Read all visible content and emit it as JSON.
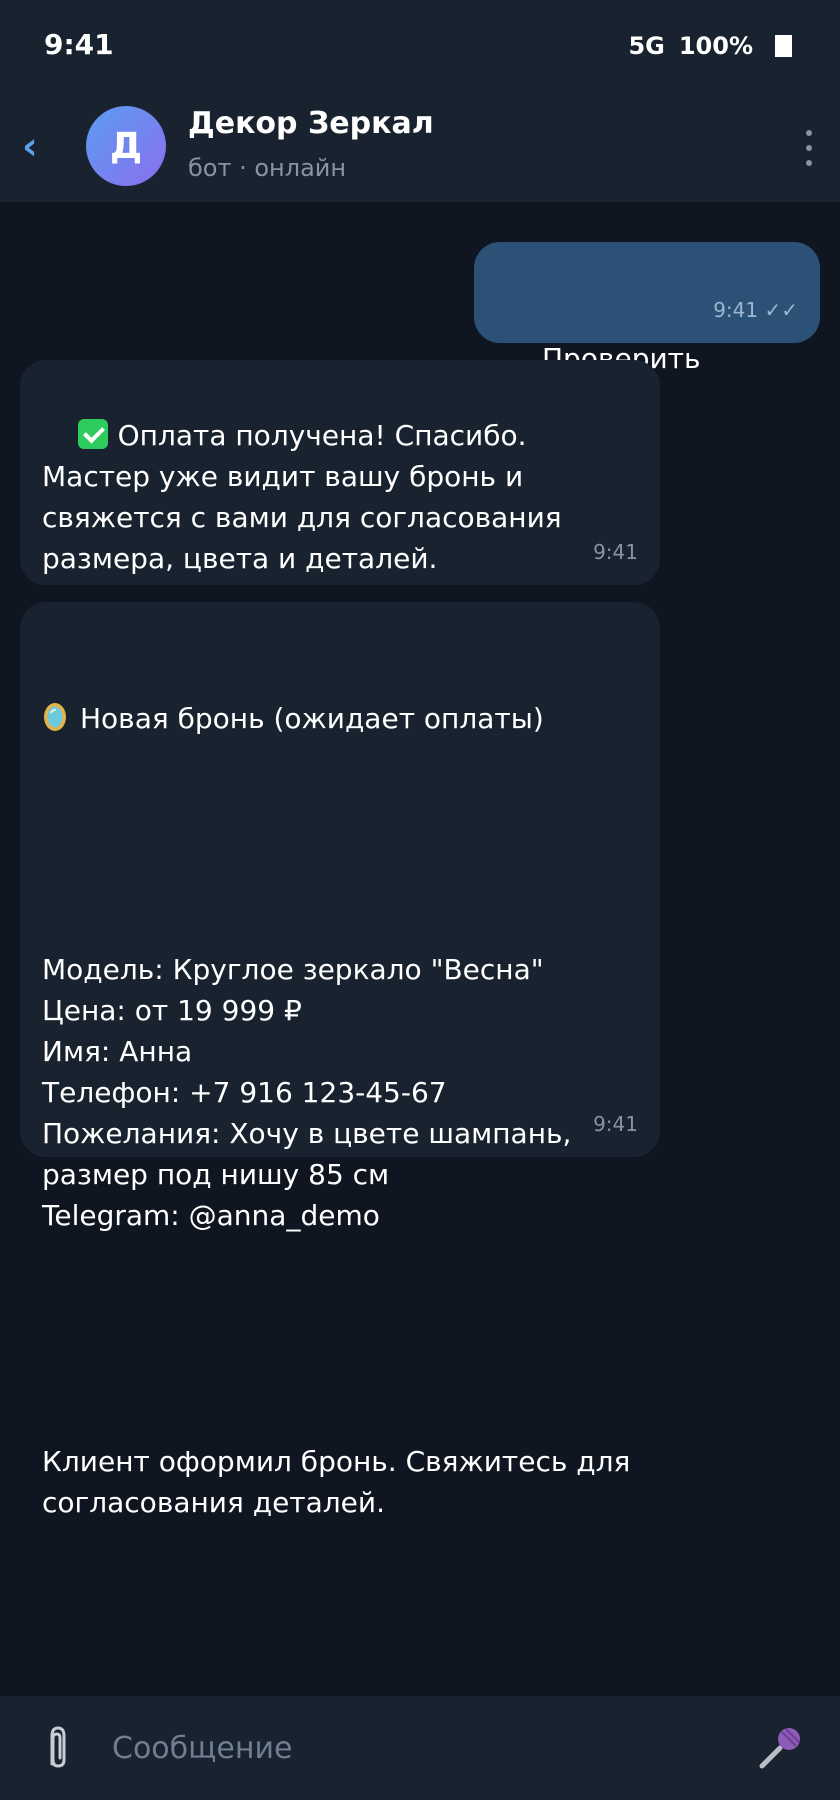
{
  "status_bar": {
    "time": "9:41",
    "network": "5G",
    "battery": "100%"
  },
  "header": {
    "avatar_letter": "Д",
    "title": "Декор Зеркал",
    "subtitle": "бот · онлайн",
    "icons": [
      "back-chevron-icon",
      "more-vert-icon"
    ]
  },
  "messages": [
    {
      "direction": "outgoing",
      "icon": "end-arrow-icon",
      "text": "Проверить оплату",
      "time": "9:41",
      "status": "✓✓"
    },
    {
      "direction": "incoming",
      "icon": "check-mark-button-icon",
      "text": "Оплата получена! Спасибо. Мастер уже видит вашу бронь и свяжется с вами для согласования размера, цвета и деталей.",
      "time": "9:41"
    },
    {
      "direction": "incoming",
      "icon": "mirror-icon",
      "title": "Новая бронь (ожидает оплаты)",
      "body": "Модель: Круглое зеркало \"Весна\"\nЦена: от 19 999 ₽\nИмя: Анна\nТелефон: +7 916 123-45-67\nПожелания: Хочу в цвете шампань,\nразмер под нишу 85 см\nTelegram: @anna_demo",
      "footer": "Клиент оформил бронь. Свяжитесь для\nсогласования деталей.",
      "time": "9:41"
    }
  ],
  "input_bar": {
    "placeholder": "Сообщение",
    "icons": [
      "paperclip-icon",
      "microphone-icon"
    ]
  },
  "colors": {
    "background": "#0f1621",
    "header": "#19222f",
    "incoming_bubble": "#19232f",
    "outgoing_bubble": "#2b5177",
    "accent": "#5ea0ea"
  }
}
